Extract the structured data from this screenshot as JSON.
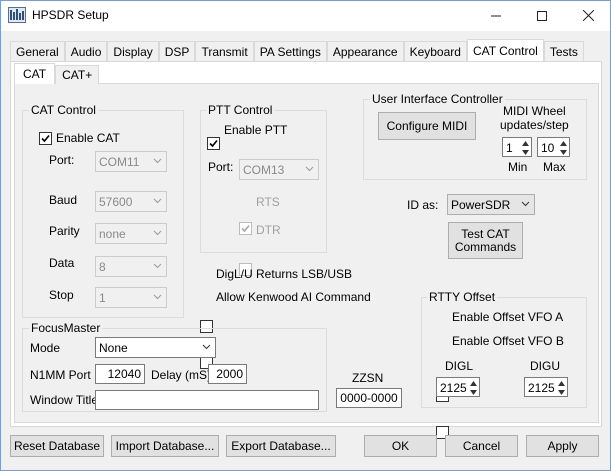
{
  "window": {
    "title": "HPSDR Setup",
    "minimize": "—",
    "maximize": "☐",
    "close": "✕"
  },
  "tabs": [
    "General",
    "Audio",
    "Display",
    "DSP",
    "Transmit",
    "PA Settings",
    "Appearance",
    "Keyboard",
    "CAT Control",
    "Tests"
  ],
  "active_tab": "CAT Control",
  "subtabs": [
    "CAT",
    "CAT+"
  ],
  "active_subtab": "CAT",
  "cat_control": {
    "legend": "CAT Control",
    "enable_label": "Enable CAT",
    "enable_checked": true,
    "port_label": "Port:",
    "port_value": "COM11",
    "baud_label": "Baud",
    "baud_value": "57600",
    "parity_label": "Parity",
    "parity_value": "none",
    "data_label": "Data",
    "data_value": "8",
    "stop_label": "Stop",
    "stop_value": "1"
  },
  "ptt_control": {
    "legend": "PTT Control",
    "enable_label": "Enable PTT",
    "enable_checked": true,
    "port_label": "Port:",
    "port_value": "COM13",
    "rts_label": "RTS",
    "rts_checked": true,
    "dtr_label": "DTR",
    "dtr_checked": false
  },
  "options": {
    "digl_label": "DigL/U Returns LSB/USB",
    "digl_checked": false,
    "kenwood_label": "Allow Kenwood AI Command",
    "kenwood_checked": false
  },
  "user_interface": {
    "legend": "User Interface Controller",
    "configure_midi": "Configure MIDI",
    "midi_wheel_line1": "MIDI  Wheel",
    "midi_wheel_line2": "updates/step",
    "min_value": "1",
    "min_label": "Min",
    "max_value": "10",
    "max_label": "Max"
  },
  "id_as": {
    "label": "ID as:",
    "value": "PowerSDR"
  },
  "test_cat": {
    "line1": "Test CAT",
    "line2": "Commands"
  },
  "rtty": {
    "legend": "RTTY Offset",
    "vfo_a_label": "Enable Offset VFO A",
    "vfo_a_checked": false,
    "vfo_b_label": "Enable Offset VFO B",
    "vfo_b_checked": false,
    "digl_label": "DIGL",
    "digl_value": "2125",
    "digu_label": "DIGU",
    "digu_value": "2125"
  },
  "focus_master": {
    "legend": "FocusMaster",
    "mode_label": "Mode",
    "mode_value": "None",
    "n1mm_label": "N1MM Port",
    "n1mm_value": "12040",
    "delay_label": "Delay (mS)",
    "delay_value": "2000",
    "window_title_label": "Window Title",
    "window_title_value": ""
  },
  "zzsn": {
    "label": "ZZSN",
    "value": "0000-0000"
  },
  "footer": {
    "reset": "Reset Database",
    "import": "Import Database...",
    "export": "Export Database...",
    "ok": "OK",
    "cancel": "Cancel",
    "apply": "Apply"
  },
  "colors": {
    "window_bg": "#f0f0f0",
    "tab_panel_bg": "#ffffff",
    "border": "#adadad",
    "disabled_text": "#a0a0a0"
  }
}
